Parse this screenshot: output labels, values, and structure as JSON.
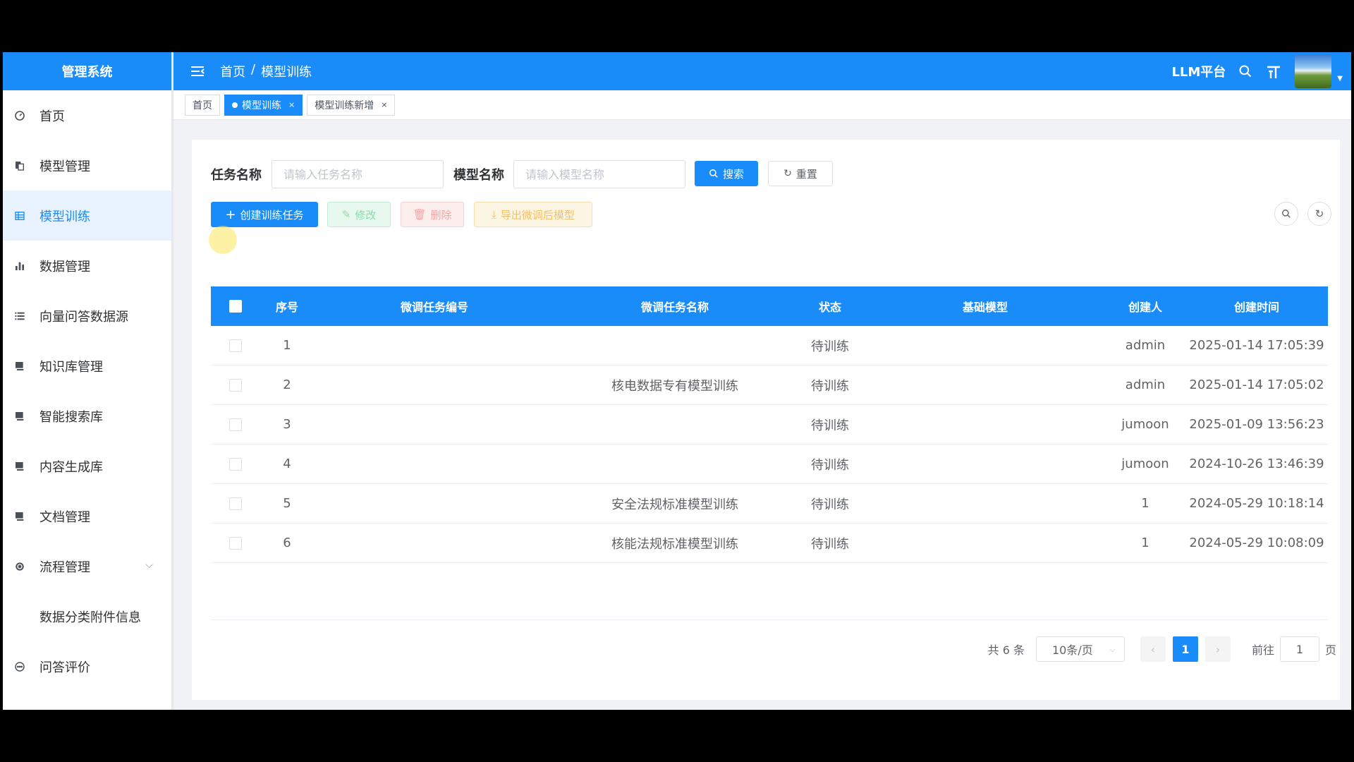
{
  "sidebar": {
    "logo": "管理系统",
    "items": [
      {
        "label": "首页",
        "icon": "dashboard-icon"
      },
      {
        "label": "模型管理",
        "icon": "documents-icon"
      },
      {
        "label": "模型训练",
        "icon": "grid-icon",
        "active": true
      },
      {
        "label": "数据管理",
        "icon": "bar-chart-icon"
      },
      {
        "label": "向量问答数据源",
        "icon": "list-icon"
      },
      {
        "label": "知识库管理",
        "icon": "monitor-icon"
      },
      {
        "label": "智能搜索库",
        "icon": "monitor-icon"
      },
      {
        "label": "内容生成库",
        "icon": "monitor-icon"
      },
      {
        "label": "文档管理",
        "icon": "monitor-icon"
      },
      {
        "label": "流程管理",
        "icon": "gear-icon"
      },
      {
        "label": "数据分类附件信息",
        "icon": ""
      },
      {
        "label": "问答评价",
        "icon": "chat-icon"
      }
    ]
  },
  "header": {
    "breadcrumb": [
      "首页",
      "/",
      "模型训练"
    ],
    "platform": "LLM平台",
    "accent": "#1a8cfa"
  },
  "tags": [
    {
      "label": "首页"
    },
    {
      "label": "模型训练",
      "active": true
    },
    {
      "label": "模型训练新增"
    }
  ],
  "search": {
    "task_label": "任务名称",
    "task_placeholder": "请输入任务名称",
    "model_label": "模型名称",
    "model_placeholder": "请输入模型名称",
    "search_btn": "搜索",
    "reset_btn": "重置"
  },
  "toolbar": {
    "create": "创建训练任务",
    "edit": "修改",
    "delete": "删除",
    "export": "导出微调后模型"
  },
  "table": {
    "columns": [
      "序号",
      "微调任务编号",
      "微调任务名称",
      "状态",
      "基础模型",
      "创建人",
      "创建时间"
    ],
    "rows": [
      {
        "no": "1",
        "code": "",
        "name": "",
        "status": "待训练",
        "base": "",
        "creator": "admin",
        "time": "2025-01-14 17:05:39"
      },
      {
        "no": "2",
        "code": "",
        "name": "核电数据专有模型训练",
        "status": "待训练",
        "base": "",
        "creator": "admin",
        "time": "2025-01-14 17:05:02"
      },
      {
        "no": "3",
        "code": "",
        "name": "",
        "status": "待训练",
        "base": "",
        "creator": "jumoon",
        "time": "2025-01-09 13:56:23"
      },
      {
        "no": "4",
        "code": "",
        "name": "",
        "status": "待训练",
        "base": "",
        "creator": "jumoon",
        "time": "2024-10-26 13:46:39"
      },
      {
        "no": "5",
        "code": "",
        "name": "安全法规标准模型训练",
        "status": "待训练",
        "base": "",
        "creator": "1",
        "time": "2024-05-29 10:18:14"
      },
      {
        "no": "6",
        "code": "",
        "name": "核能法规标准模型训练",
        "status": "待训练",
        "base": "",
        "creator": "1",
        "time": "2024-05-29 10:08:09"
      }
    ]
  },
  "pagination": {
    "total": "共 6 条",
    "page_size": "10条/页",
    "current": "1",
    "goto_prefix": "前往",
    "goto_value": "1",
    "goto_suffix": "页"
  }
}
